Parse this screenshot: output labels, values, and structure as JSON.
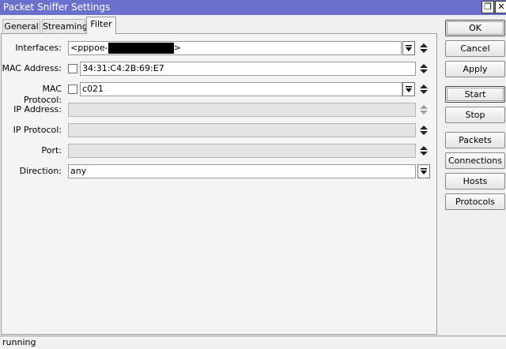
{
  "window": {
    "title": "Packet Sniffer Settings",
    "restore_glyph": "❐",
    "close_glyph": "✕"
  },
  "tabs": [
    {
      "label": "General",
      "active": false
    },
    {
      "label": "Streaming",
      "active": false
    },
    {
      "label": "Filter",
      "active": true
    }
  ],
  "filter": {
    "interfaces": {
      "label": "Interfaces:",
      "value_prefix": "<pppoe-",
      "value_suffix": ">"
    },
    "mac_address": {
      "label": "MAC Address:",
      "value": "34:31:C4:2B:69:E7",
      "negate_checked": false
    },
    "mac_protocol": {
      "label": "MAC Protocol:",
      "value": "c021",
      "negate_checked": false
    },
    "ip_address": {
      "label": "IP Address:",
      "value": ""
    },
    "ip_protocol": {
      "label": "IP Protocol:",
      "value": ""
    },
    "port": {
      "label": "Port:",
      "value": ""
    },
    "direction": {
      "label": "Direction:",
      "value": "any"
    }
  },
  "buttons": {
    "ok": "OK",
    "cancel": "Cancel",
    "apply": "Apply",
    "start": "Start",
    "stop": "Stop",
    "packets": "Packets",
    "connections": "Connections",
    "hosts": "Hosts",
    "protocols": "Protocols"
  },
  "status": {
    "text": "running"
  },
  "icons": {
    "dropdown": "dropdown-arrow-icon",
    "updown": "up-down-arrows-icon",
    "restore": "restore-window-icon",
    "close": "close-icon"
  },
  "colors": {
    "titlebar": "#6b70cc",
    "panel": "#f4f4f4",
    "disabled_field": "#e4e4e4"
  }
}
